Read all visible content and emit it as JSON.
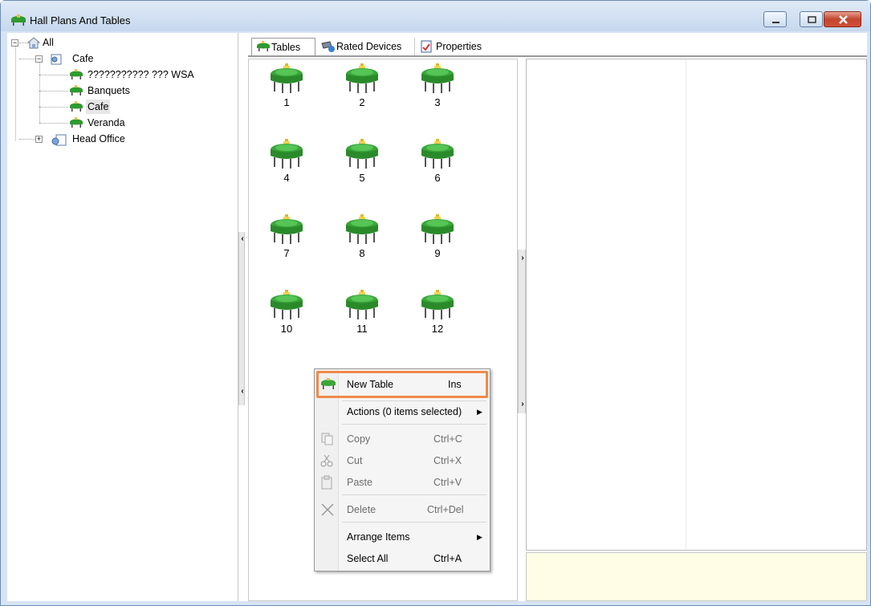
{
  "window": {
    "title": "Hall Plans And Tables",
    "colors": {
      "accent": "#f08a4b",
      "table_green": "#2f9a2f",
      "info_bg": "#fffde6"
    }
  },
  "tree": {
    "root": "All",
    "cafe": "Cafe",
    "children": [
      "??????????? ??? WSA",
      "Banquets",
      "Cafe",
      "Veranda"
    ],
    "head_office": "Head Office"
  },
  "tabs": [
    {
      "label": "Tables",
      "icon": "table-icon"
    },
    {
      "label": "Rated Devices",
      "icon": "device-icon"
    },
    {
      "label": "Properties",
      "icon": "properties-icon"
    }
  ],
  "tables": [
    "1",
    "2",
    "3",
    "4",
    "5",
    "6",
    "7",
    "8",
    "9",
    "10",
    "11",
    "12"
  ],
  "context_menu": {
    "new_table": {
      "label": "New Table",
      "shortcut": "Ins"
    },
    "actions": {
      "label": "Actions (0 items selected)"
    },
    "copy": {
      "label": "Copy",
      "shortcut": "Ctrl+C"
    },
    "cut": {
      "label": "Cut",
      "shortcut": "Ctrl+X"
    },
    "paste": {
      "label": "Paste",
      "shortcut": "Ctrl+V"
    },
    "delete": {
      "label": "Delete",
      "shortcut": "Ctrl+Del"
    },
    "arrange": {
      "label": "Arrange Items"
    },
    "select_all": {
      "label": "Select All",
      "shortcut": "Ctrl+A"
    }
  }
}
